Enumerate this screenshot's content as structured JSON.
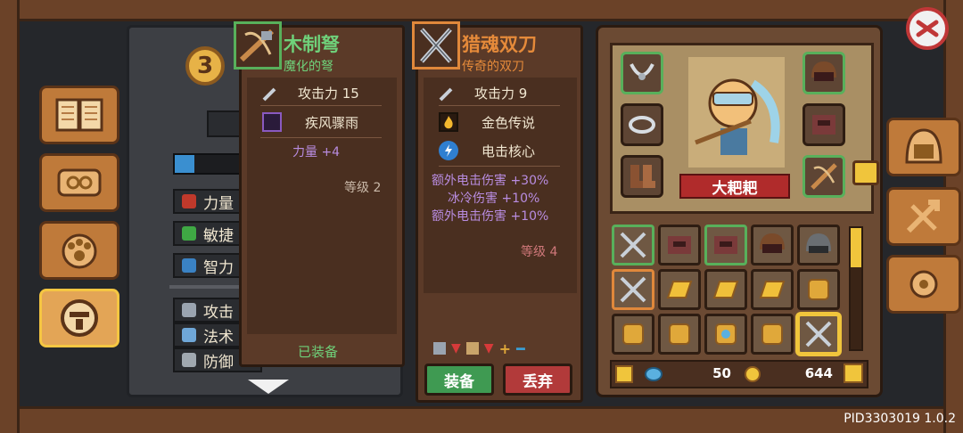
{
  "level": "3",
  "stats": [
    {
      "label": "力量",
      "color": "#c0392b"
    },
    {
      "label": "敏捷",
      "color": "#3fa844"
    },
    {
      "label": "智力",
      "color": "#3a82c4"
    }
  ],
  "combat": [
    {
      "label": "攻击",
      "color": "#9aa4b0"
    },
    {
      "label": "法术",
      "color": "#6fa7d8"
    },
    {
      "label": "防御",
      "color": "#a0a8b0"
    }
  ],
  "tooltip_equipped": {
    "title": "木制弩",
    "subtitle": "魔化的弩",
    "title_color": "#6fd17a",
    "attack": "攻击力 15",
    "skill": "疾风骤雨",
    "bonus": "力量 +4",
    "level": "等级 2",
    "status": "已装备"
  },
  "tooltip_new": {
    "title": "猎魂双刀",
    "subtitle": "传奇的双刀",
    "title_color": "#e58a3a",
    "attack": "攻击力 9",
    "skills": [
      "金色传说",
      "电击核心"
    ],
    "bonuses": [
      "额外电击伤害 +30%",
      "冰冷伤害 +10%",
      "额外电击伤害 +10%"
    ],
    "level": "等级 4",
    "equip_label": "装备",
    "discard_label": "丢弃"
  },
  "character": {
    "name": "大耙耙"
  },
  "currency": {
    "gems": "50",
    "gold": "644"
  },
  "version": "PID3303019 1.0.2",
  "colors": {
    "accent_gold": "#f5c642",
    "legendary": "#e58a3a",
    "rare": "#6fd17a",
    "bonus_purple": "#b88ce0",
    "level_red": "#d0787a"
  }
}
